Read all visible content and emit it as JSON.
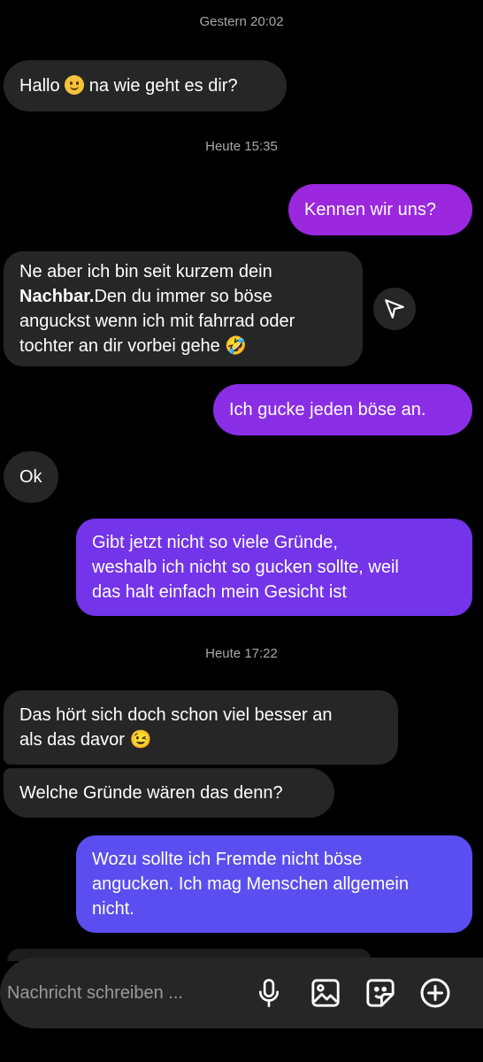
{
  "thread": {
    "timestamps": {
      "t1": "Gestern 20:02",
      "t2": "Heute 15:35",
      "t3": "Heute 17:22"
    },
    "messages": {
      "m1_before": "Hallo ",
      "m1_after": " na wie geht es dir?",
      "m2": "Kennen wir uns?",
      "m3_line1": "Ne aber ich bin seit kurzem dein",
      "m3_bold": "Nachbar.",
      "m3_line2_rest": "Den du immer so böse",
      "m3_line3": "anguckst wenn ich mit fahrrad oder",
      "m3_line4": "tochter an dir vorbei gehe 🤣",
      "m4": "Ich gucke jeden böse an.",
      "m5": "Ok",
      "m6_line1": "Gibt jetzt nicht so viele Gründe,",
      "m6_line2": "weshalb ich nicht so gucken sollte, weil",
      "m6_line3": "das halt einfach mein Gesicht ist",
      "m7_line1": "Das hört sich doch schon viel besser an",
      "m7_line2": "als das davor 😉",
      "m8": "Welche Gründe wären das denn?",
      "m9_line1": "Wozu sollte ich Fremde nicht böse",
      "m9_line2": "angucken. Ich mag Menschen allgemein",
      "m9_line3": "nicht."
    }
  },
  "composer": {
    "placeholder": "Nachricht schreiben ...",
    "icons": [
      "microphone-icon",
      "image-icon",
      "sticker-icon",
      "plus-icon"
    ]
  },
  "colors": {
    "incoming": "#262626",
    "outgoing_top": "#9b27e0",
    "outgoing_bottom": "#5b4ef0",
    "background": "#000000"
  }
}
